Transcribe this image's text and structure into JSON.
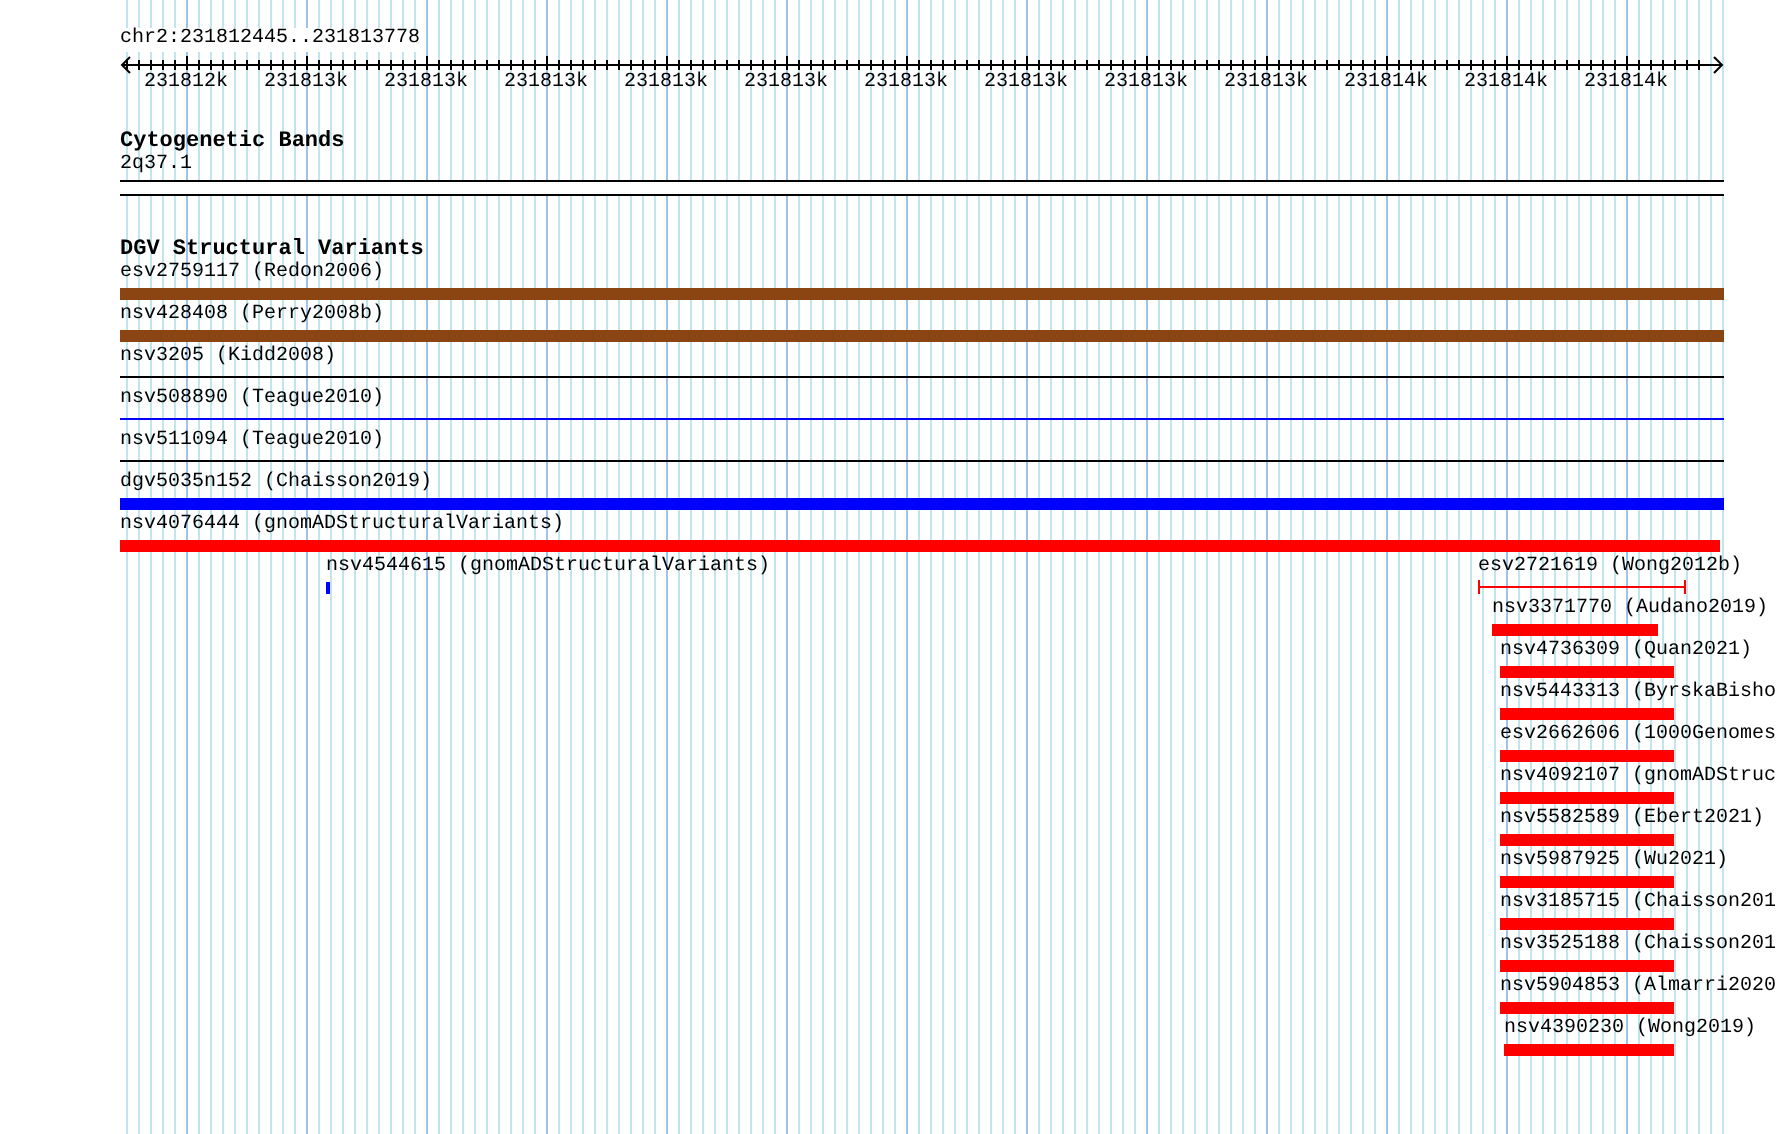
{
  "location": "chr2:231812445..231813778",
  "ruler": {
    "ticks": [
      "231812k",
      "231813k",
      "231813k",
      "231813k",
      "231813k",
      "231813k",
      "231813k",
      "231813k",
      "231813k",
      "231813k",
      "231814k",
      "231814k",
      "231814k"
    ]
  },
  "tracks": [
    {
      "title": "Cytogenetic Bands",
      "features": [
        {
          "label": "2q37.1",
          "kind": "band"
        }
      ]
    },
    {
      "title": "DGV Structural Variants",
      "features": [
        {
          "label": "esv2759117 (Redon2006)",
          "kind": "thick",
          "color": "#8b4513"
        },
        {
          "label": "nsv428408 (Perry2008b)",
          "kind": "thick",
          "color": "#8b4513"
        },
        {
          "label": "nsv3205 (Kidd2008)",
          "kind": "line",
          "color": "#000000"
        },
        {
          "label": "nsv508890 (Teague2010)",
          "kind": "line",
          "color": "#0000ff"
        },
        {
          "label": "nsv511094 (Teague2010)",
          "kind": "line",
          "color": "#000000"
        },
        {
          "label": "dgv5035n152 (Chaisson2019)",
          "kind": "thick",
          "color": "#0000ff"
        },
        {
          "label": "nsv4076444 (gnomADStructuralVariants)",
          "kind": "thick",
          "color": "#ff0000"
        },
        {
          "label": "nsv4544615 (gnomADStructuralVariants)",
          "kind": "thick",
          "color": "#0000ff"
        },
        {
          "label": "esv2721619 (Wong2012b)",
          "kind": "span",
          "color": "#ff0000"
        },
        {
          "label": "nsv3371770 (Audano2019)",
          "kind": "thick",
          "color": "#ff0000"
        },
        {
          "label": "nsv4736309 (Quan2021)",
          "kind": "thick",
          "color": "#ff0000"
        },
        {
          "label": "nsv5443313 (ByrskaBisho",
          "kind": "thick",
          "color": "#ff0000"
        },
        {
          "label": "esv2662606 (1000Genomes",
          "kind": "thick",
          "color": "#ff0000"
        },
        {
          "label": "nsv4092107 (gnomADStruc",
          "kind": "thick",
          "color": "#ff0000"
        },
        {
          "label": "nsv5582589 (Ebert2021)",
          "kind": "thick",
          "color": "#ff0000"
        },
        {
          "label": "nsv5987925 (Wu2021)",
          "kind": "thick",
          "color": "#ff0000"
        },
        {
          "label": "nsv3185715 (Chaisson201",
          "kind": "thick",
          "color": "#ff0000"
        },
        {
          "label": "nsv3525188 (Chaisson201",
          "kind": "thick",
          "color": "#ff0000"
        },
        {
          "label": "nsv5904853 (Almarri2020",
          "kind": "thick",
          "color": "#ff0000"
        },
        {
          "label": "nsv4390230 (Wong2019)",
          "kind": "thick",
          "color": "#ff0000"
        }
      ]
    }
  ]
}
